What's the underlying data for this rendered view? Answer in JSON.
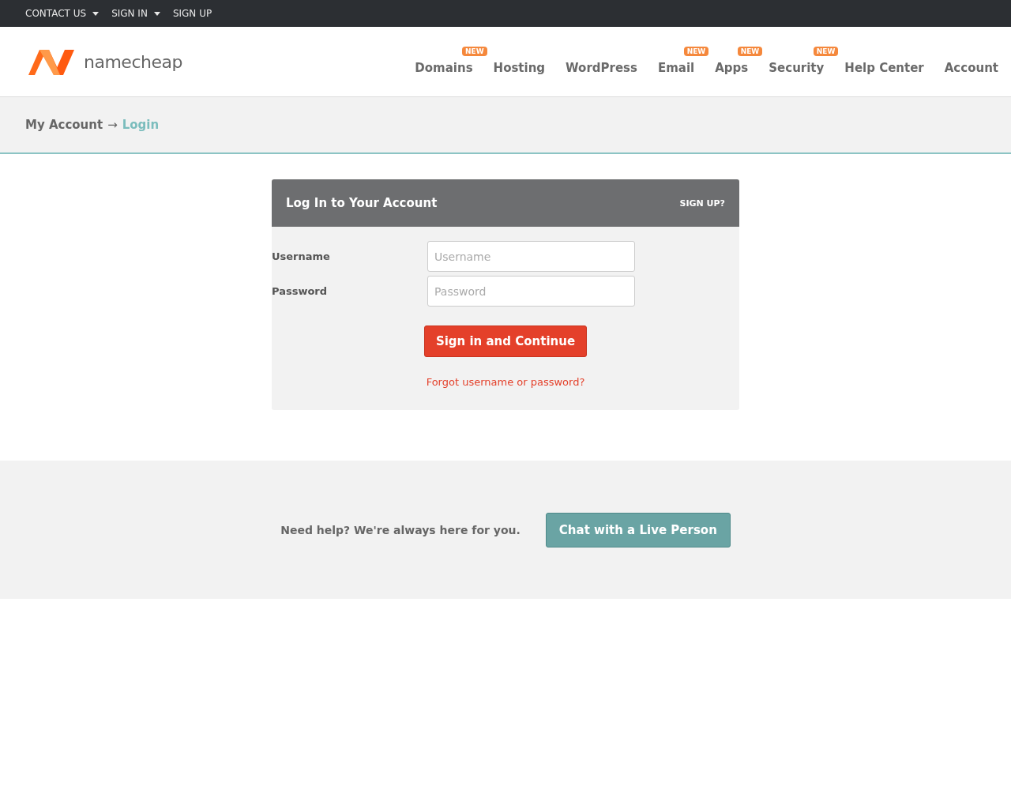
{
  "top_bar": {
    "links": [
      {
        "label": "CONTACT US",
        "dropdown": true
      },
      {
        "label": "SIGN IN",
        "dropdown": true
      },
      {
        "label": "SIGN UP",
        "dropdown": false
      }
    ]
  },
  "header": {
    "logo_text": "namecheap",
    "nav": [
      {
        "label": "Domains",
        "badge": "NEW"
      },
      {
        "label": "Hosting"
      },
      {
        "label": "WordPress"
      },
      {
        "label": "Email",
        "badge": "NEW"
      },
      {
        "label": "Apps",
        "badge": "NEW"
      },
      {
        "label": "Security",
        "badge": "NEW"
      },
      {
        "label": "Help Center"
      },
      {
        "label": "Account"
      }
    ]
  },
  "breadcrumb": {
    "parent": "My Account",
    "separator": "→",
    "current": "Login"
  },
  "login": {
    "title": "Log In to Your Account",
    "signup_link": "SIGN UP?",
    "fields": [
      {
        "label": "Username",
        "placeholder": "Username"
      },
      {
        "label": "Password",
        "placeholder": "Password"
      }
    ],
    "submit": "Sign in and Continue",
    "forgot": "Forgot username or password?"
  },
  "help": {
    "text": "Need help? We're always here for you.",
    "button": "Chat with a Live Person"
  }
}
